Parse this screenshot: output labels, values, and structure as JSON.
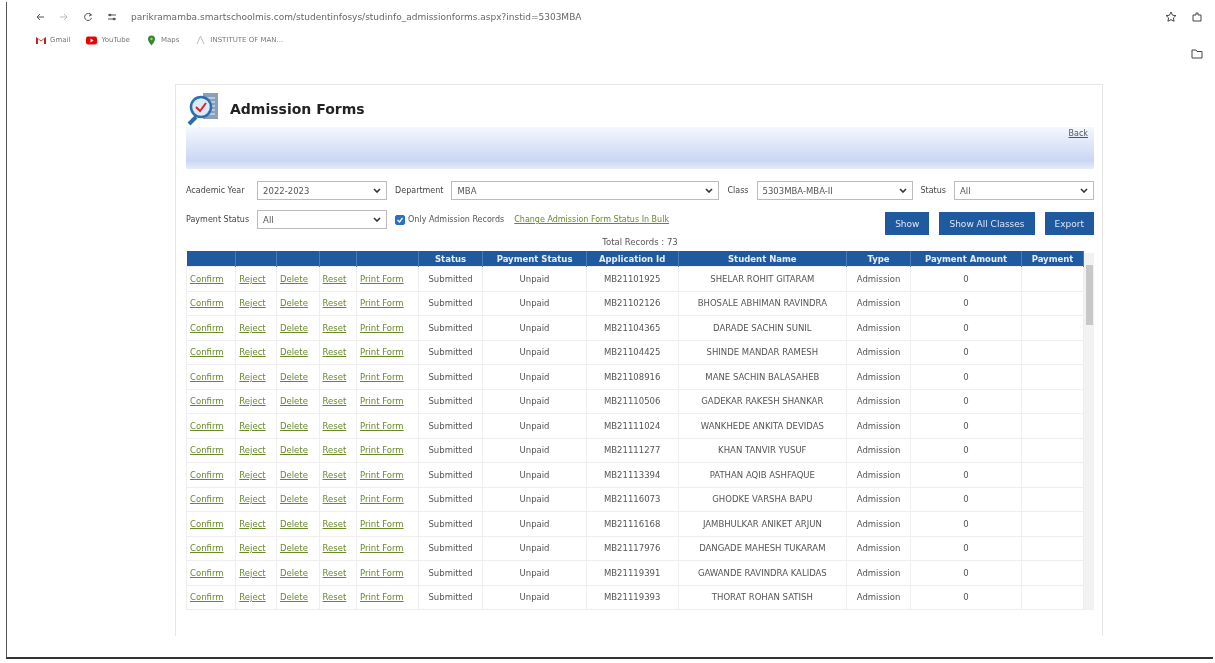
{
  "browser": {
    "url": "parikramamba.smartschoolmis.com/studentinfosys/studinfo_admissionforms.aspx?instid=5303MBA",
    "bookmarks": [
      "Gmail",
      "YouTube",
      "Maps",
      "INSTITUTE OF MAN..."
    ]
  },
  "page": {
    "title": "Admission Forms",
    "back_link": "Back"
  },
  "filters": {
    "selects": [
      {
        "label": "Academic Year",
        "value": "2022-2023"
      },
      {
        "label": "Department",
        "value": "MBA"
      },
      {
        "label": "Class",
        "value": "5303MBA-MBA-II"
      },
      {
        "label": "Status",
        "value": "All"
      },
      {
        "label": "Payment Status",
        "value": "All"
      }
    ],
    "only_admission_records": {
      "label": "Only Admission Records",
      "checked": true
    },
    "bulk_link": "Change Admission Form Status In Bulk",
    "buttons": [
      "Show",
      "Show All Classes",
      "Export"
    ]
  },
  "total_records": "Total Records : 73",
  "table": {
    "columns": [
      "",
      "",
      "",
      "",
      "",
      "Status",
      "Payment Status",
      "Application Id",
      "Student Name",
      "Type",
      "Payment Amount",
      "Payment"
    ],
    "rows": [
      {
        "actions": [
          "Confirm",
          "Reject",
          "Delete",
          "Reset",
          "Print Form"
        ],
        "status": "Submitted",
        "payment_status": "Unpaid",
        "application_id": "MB21101925",
        "student_name": "SHELAR ROHIT GITARAM",
        "type": "Admission",
        "payment_amount": "0"
      },
      {
        "actions": [
          "Confirm",
          "Reject",
          "Delete",
          "Reset",
          "Print Form"
        ],
        "status": "Submitted",
        "payment_status": "Unpaid",
        "application_id": "MB21102126",
        "student_name": "BHOSALE ABHIMAN RAVINDRA",
        "type": "Admission",
        "payment_amount": "0"
      },
      {
        "actions": [
          "Confirm",
          "Reject",
          "Delete",
          "Reset",
          "Print Form"
        ],
        "status": "Submitted",
        "payment_status": "Unpaid",
        "application_id": "MB21104365",
        "student_name": "DARADE SACHIN SUNIL",
        "type": "Admission",
        "payment_amount": "0"
      },
      {
        "actions": [
          "Confirm",
          "Reject",
          "Delete",
          "Reset",
          "Print Form"
        ],
        "status": "Submitted",
        "payment_status": "Unpaid",
        "application_id": "MB21104425",
        "student_name": "SHINDE MANDAR RAMESH",
        "type": "Admission",
        "payment_amount": "0"
      },
      {
        "actions": [
          "Confirm",
          "Reject",
          "Delete",
          "Reset",
          "Print Form"
        ],
        "status": "Submitted",
        "payment_status": "Unpaid",
        "application_id": "MB21108916",
        "student_name": "MANE SACHIN BALASAHEB",
        "type": "Admission",
        "payment_amount": "0"
      },
      {
        "actions": [
          "Confirm",
          "Reject",
          "Delete",
          "Reset",
          "Print Form"
        ],
        "status": "Submitted",
        "payment_status": "Unpaid",
        "application_id": "MB21110506",
        "student_name": "GADEKAR RAKESH SHANKAR",
        "type": "Admission",
        "payment_amount": "0"
      },
      {
        "actions": [
          "Confirm",
          "Reject",
          "Delete",
          "Reset",
          "Print Form"
        ],
        "status": "Submitted",
        "payment_status": "Unpaid",
        "application_id": "MB21111024",
        "student_name": "WANKHEDE ANKITA DEVIDAS",
        "type": "Admission",
        "payment_amount": "0"
      },
      {
        "actions": [
          "Confirm",
          "Reject",
          "Delete",
          "Reset",
          "Print Form"
        ],
        "status": "Submitted",
        "payment_status": "Unpaid",
        "application_id": "MB21111277",
        "student_name": "KHAN TANVIR YUSUF",
        "type": "Admission",
        "payment_amount": "0"
      },
      {
        "actions": [
          "Confirm",
          "Reject",
          "Delete",
          "Reset",
          "Print Form"
        ],
        "status": "Submitted",
        "payment_status": "Unpaid",
        "application_id": "MB21113394",
        "student_name": "PATHAN AQIB ASHFAQUE",
        "type": "Admission",
        "payment_amount": "0"
      },
      {
        "actions": [
          "Confirm",
          "Reject",
          "Delete",
          "Reset",
          "Print Form"
        ],
        "status": "Submitted",
        "payment_status": "Unpaid",
        "application_id": "MB21116073",
        "student_name": "GHODKE VARSHA BAPU",
        "type": "Admission",
        "payment_amount": "0"
      },
      {
        "actions": [
          "Confirm",
          "Reject",
          "Delete",
          "Reset",
          "Print Form"
        ],
        "status": "Submitted",
        "payment_status": "Unpaid",
        "application_id": "MB21116168",
        "student_name": "JAMBHULKAR ANIKET ARJUN",
        "type": "Admission",
        "payment_amount": "0"
      },
      {
        "actions": [
          "Confirm",
          "Reject",
          "Delete",
          "Reset",
          "Print Form"
        ],
        "status": "Submitted",
        "payment_status": "Unpaid",
        "application_id": "MB21117976",
        "student_name": "DANGADE MAHESH TUKARAM",
        "type": "Admission",
        "payment_amount": "0"
      },
      {
        "actions": [
          "Confirm",
          "Reject",
          "Delete",
          "Reset",
          "Print Form"
        ],
        "status": "Submitted",
        "payment_status": "Unpaid",
        "application_id": "MB21119391",
        "student_name": "GAWANDE RAVINDRA KALIDAS",
        "type": "Admission",
        "payment_amount": "0"
      },
      {
        "actions": [
          "Confirm",
          "Reject",
          "Delete",
          "Reset",
          "Print Form"
        ],
        "status": "Submitted",
        "payment_status": "Unpaid",
        "application_id": "MB21119393",
        "student_name": "THORAT ROHAN SATISH",
        "type": "Admission",
        "payment_amount": "0"
      }
    ]
  }
}
